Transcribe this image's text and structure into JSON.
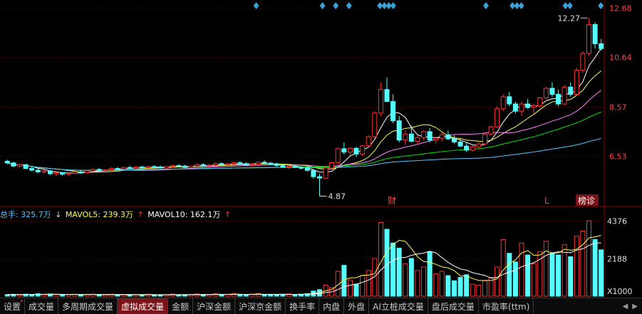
{
  "price_axis": {
    "ticks": [
      "12.68",
      "10.64",
      "8.57",
      "6.53"
    ]
  },
  "volume_axis": {
    "ticks": [
      "4376",
      "2188"
    ],
    "unit": "X1000"
  },
  "annotations": {
    "max_price": "12.27",
    "min_price": "4.87",
    "marker_cai": "财",
    "marker_l": "L",
    "marker_bangzhen": "榜诊"
  },
  "volume_header": {
    "total": "总手: 325.7万",
    "mavol5": "MAVOL5: 239.3万",
    "mavol10": "MAVOL10: 162.1万"
  },
  "tabs": [
    {
      "label": "设置",
      "dot": true
    },
    {
      "label": "成交量"
    },
    {
      "label": "多周期成交量"
    },
    {
      "label": "虚拟成交量",
      "active": true
    },
    {
      "label": "金额"
    },
    {
      "label": "沪深金额"
    },
    {
      "label": "沪深京金额"
    },
    {
      "label": "换手率"
    },
    {
      "label": "内盘"
    },
    {
      "label": "外盘"
    },
    {
      "label": "AI立桩成交量"
    },
    {
      "label": "盘后成交量"
    },
    {
      "label": "市盈率(ttm)"
    }
  ],
  "colors": {
    "up": "#ff3232",
    "down": "#54ffff",
    "ma_white": "#ffffff",
    "ma_yellow": "#ffff54",
    "ma_magenta": "#ff80ff",
    "ma_green": "#00e600",
    "ma_blue": "#55c8ff",
    "diamond": "#3aa0d8"
  },
  "chart_data": {
    "type": "candlestick",
    "candles": [
      [
        6.32,
        6.38,
        6.2,
        6.25
      ],
      [
        6.25,
        6.3,
        6.08,
        6.12
      ],
      [
        6.12,
        6.22,
        6.05,
        6.18
      ],
      [
        6.18,
        6.2,
        5.98,
        6.02
      ],
      [
        6.02,
        6.1,
        5.9,
        5.95
      ],
      [
        5.95,
        6.02,
        5.82,
        5.88
      ],
      [
        5.88,
        5.98,
        5.8,
        5.92
      ],
      [
        5.92,
        5.96,
        5.75,
        5.8
      ],
      [
        5.8,
        5.9,
        5.7,
        5.85
      ],
      [
        5.85,
        5.88,
        5.72,
        5.78
      ],
      [
        5.78,
        5.86,
        5.7,
        5.82
      ],
      [
        5.82,
        5.92,
        5.78,
        5.88
      ],
      [
        5.88,
        5.95,
        5.8,
        5.84
      ],
      [
        5.84,
        5.96,
        5.8,
        5.92
      ],
      [
        5.92,
        6.02,
        5.88,
        5.98
      ],
      [
        5.98,
        6.04,
        5.9,
        5.94
      ],
      [
        5.94,
        6.0,
        5.86,
        5.96
      ],
      [
        5.96,
        6.06,
        5.92,
        6.02
      ],
      [
        6.02,
        6.08,
        5.96,
        6.0
      ],
      [
        6.0,
        6.1,
        5.96,
        6.06
      ],
      [
        6.06,
        6.14,
        6.0,
        6.04
      ],
      [
        6.04,
        6.1,
        5.98,
        6.08
      ],
      [
        6.08,
        6.14,
        6.02,
        6.06
      ],
      [
        6.06,
        6.12,
        6.0,
        6.1
      ],
      [
        6.1,
        6.16,
        6.04,
        6.08
      ],
      [
        6.08,
        6.14,
        6.02,
        6.04
      ],
      [
        6.04,
        6.12,
        6.0,
        6.1
      ],
      [
        6.1,
        6.18,
        6.06,
        6.14
      ],
      [
        6.14,
        6.2,
        6.08,
        6.12
      ],
      [
        6.12,
        6.18,
        6.04,
        6.06
      ],
      [
        6.06,
        6.14,
        6.02,
        6.12
      ],
      [
        6.12,
        6.22,
        6.08,
        6.18
      ],
      [
        6.18,
        6.24,
        6.1,
        6.14
      ],
      [
        6.14,
        6.2,
        6.08,
        6.16
      ],
      [
        6.16,
        6.26,
        6.12,
        6.22
      ],
      [
        6.22,
        6.28,
        6.14,
        6.18
      ],
      [
        6.18,
        6.24,
        6.1,
        6.2
      ],
      [
        6.2,
        6.3,
        6.16,
        6.26
      ],
      [
        6.26,
        6.32,
        6.18,
        6.22
      ],
      [
        6.22,
        6.28,
        6.14,
        6.16
      ],
      [
        6.16,
        6.24,
        6.1,
        6.2
      ],
      [
        6.2,
        6.3,
        6.16,
        6.28
      ],
      [
        6.28,
        6.36,
        6.22,
        6.24
      ],
      [
        6.24,
        6.3,
        6.16,
        6.2
      ],
      [
        6.2,
        6.26,
        6.1,
        6.14
      ],
      [
        6.14,
        6.2,
        6.04,
        6.08
      ],
      [
        6.08,
        6.16,
        6.0,
        6.12
      ],
      [
        6.12,
        6.18,
        6.04,
        6.06
      ],
      [
        6.06,
        6.12,
        5.98,
        6.04
      ],
      [
        6.04,
        6.1,
        5.9,
        5.94
      ],
      [
        5.94,
        6.0,
        5.6,
        5.68
      ],
      [
        5.68,
        5.8,
        4.87,
        5.62
      ],
      [
        5.62,
        6.1,
        5.58,
        6.04
      ],
      [
        6.04,
        6.3,
        6.0,
        6.26
      ],
      [
        6.26,
        6.9,
        6.2,
        6.84
      ],
      [
        6.84,
        7.1,
        6.6,
        6.7
      ],
      [
        6.7,
        6.9,
        6.56,
        6.86
      ],
      [
        6.86,
        6.92,
        6.5,
        6.62
      ],
      [
        6.62,
        7.0,
        6.55,
        6.96
      ],
      [
        6.96,
        7.4,
        6.88,
        7.34
      ],
      [
        7.34,
        8.4,
        7.28,
        8.32
      ],
      [
        8.32,
        9.6,
        8.2,
        9.3
      ],
      [
        9.3,
        9.8,
        8.9,
        8.8
      ],
      [
        8.8,
        9.1,
        7.9,
        8.0
      ],
      [
        8.0,
        8.2,
        7.1,
        7.2
      ],
      [
        7.2,
        7.6,
        7.0,
        7.45
      ],
      [
        7.45,
        7.8,
        7.1,
        7.15
      ],
      [
        7.15,
        7.4,
        7.0,
        7.3
      ],
      [
        7.3,
        7.6,
        7.2,
        7.55
      ],
      [
        7.55,
        7.7,
        7.1,
        7.2
      ],
      [
        7.2,
        7.35,
        7.05,
        7.28
      ],
      [
        7.28,
        7.5,
        7.15,
        7.42
      ],
      [
        7.42,
        7.6,
        7.2,
        7.25
      ],
      [
        7.25,
        7.4,
        7.05,
        7.12
      ],
      [
        7.12,
        7.25,
        6.9,
        6.95
      ],
      [
        6.95,
        7.1,
        6.7,
        6.78
      ],
      [
        6.78,
        7.0,
        6.72,
        6.92
      ],
      [
        6.92,
        7.1,
        6.85,
        7.04
      ],
      [
        7.04,
        7.5,
        7.0,
        7.45
      ],
      [
        7.45,
        7.8,
        7.4,
        7.75
      ],
      [
        7.75,
        8.6,
        7.7,
        8.5
      ],
      [
        8.5,
        9.1,
        8.4,
        9.0
      ],
      [
        9.0,
        9.2,
        8.6,
        8.7
      ],
      [
        8.7,
        8.8,
        8.3,
        8.4
      ],
      [
        8.4,
        8.8,
        8.2,
        8.7
      ],
      [
        8.7,
        8.9,
        8.5,
        8.55
      ],
      [
        8.55,
        8.7,
        8.3,
        8.62
      ],
      [
        8.62,
        9.0,
        8.55,
        8.95
      ],
      [
        8.95,
        9.4,
        8.9,
        9.35
      ],
      [
        9.35,
        9.6,
        9.0,
        9.1
      ],
      [
        9.1,
        9.3,
        8.6,
        8.7
      ],
      [
        8.7,
        9.5,
        8.65,
        9.4
      ],
      [
        9.4,
        9.6,
        9.0,
        9.1
      ],
      [
        9.1,
        10.2,
        9.05,
        10.1
      ],
      [
        10.1,
        10.9,
        10.0,
        10.8
      ],
      [
        10.8,
        12.27,
        10.7,
        12.0
      ],
      [
        12.0,
        12.1,
        11.0,
        11.2
      ],
      [
        11.2,
        11.4,
        10.9,
        11.0
      ]
    ],
    "volumes": [
      [
        95,
        "down"
      ],
      [
        110,
        "down"
      ],
      [
        80,
        "up"
      ],
      [
        120,
        "down"
      ],
      [
        105,
        "down"
      ],
      [
        140,
        "down"
      ],
      [
        90,
        "up"
      ],
      [
        130,
        "down"
      ],
      [
        100,
        "up"
      ],
      [
        85,
        "down"
      ],
      [
        95,
        "up"
      ],
      [
        110,
        "up"
      ],
      [
        80,
        "down"
      ],
      [
        100,
        "up"
      ],
      [
        120,
        "up"
      ],
      [
        70,
        "down"
      ],
      [
        90,
        "up"
      ],
      [
        115,
        "up"
      ],
      [
        75,
        "down"
      ],
      [
        105,
        "up"
      ],
      [
        80,
        "down"
      ],
      [
        95,
        "up"
      ],
      [
        70,
        "down"
      ],
      [
        110,
        "up"
      ],
      [
        85,
        "down"
      ],
      [
        60,
        "down"
      ],
      [
        95,
        "up"
      ],
      [
        125,
        "up"
      ],
      [
        70,
        "down"
      ],
      [
        80,
        "down"
      ],
      [
        100,
        "up"
      ],
      [
        130,
        "up"
      ],
      [
        90,
        "down"
      ],
      [
        100,
        "up"
      ],
      [
        140,
        "up"
      ],
      [
        75,
        "down"
      ],
      [
        110,
        "up"
      ],
      [
        150,
        "up"
      ],
      [
        85,
        "down"
      ],
      [
        70,
        "down"
      ],
      [
        120,
        "up"
      ],
      [
        160,
        "up"
      ],
      [
        90,
        "down"
      ],
      [
        80,
        "down"
      ],
      [
        100,
        "down"
      ],
      [
        110,
        "down"
      ],
      [
        130,
        "up"
      ],
      [
        95,
        "down"
      ],
      [
        110,
        "down"
      ],
      [
        150,
        "down"
      ],
      [
        300,
        "down"
      ],
      [
        380,
        "down"
      ],
      [
        650,
        "up"
      ],
      [
        500,
        "up"
      ],
      [
        1450,
        "up"
      ],
      [
        1800,
        "down"
      ],
      [
        950,
        "up"
      ],
      [
        700,
        "down"
      ],
      [
        1200,
        "up"
      ],
      [
        1500,
        "up"
      ],
      [
        2200,
        "up"
      ],
      [
        4300,
        "up"
      ],
      [
        3900,
        "down"
      ],
      [
        3100,
        "down"
      ],
      [
        2800,
        "down"
      ],
      [
        1900,
        "up"
      ],
      [
        2200,
        "down"
      ],
      [
        1500,
        "up"
      ],
      [
        1700,
        "up"
      ],
      [
        2600,
        "down"
      ],
      [
        1300,
        "up"
      ],
      [
        1450,
        "up"
      ],
      [
        1200,
        "down"
      ],
      [
        900,
        "down"
      ],
      [
        1100,
        "down"
      ],
      [
        1250,
        "down"
      ],
      [
        700,
        "up"
      ],
      [
        650,
        "up"
      ],
      [
        900,
        "up"
      ],
      [
        1100,
        "up"
      ],
      [
        1700,
        "up"
      ],
      [
        3300,
        "up"
      ],
      [
        2500,
        "down"
      ],
      [
        2000,
        "down"
      ],
      [
        3100,
        "up"
      ],
      [
        2400,
        "down"
      ],
      [
        1900,
        "up"
      ],
      [
        2600,
        "up"
      ],
      [
        3200,
        "up"
      ],
      [
        2500,
        "down"
      ],
      [
        2400,
        "down"
      ],
      [
        3000,
        "up"
      ],
      [
        2300,
        "down"
      ],
      [
        3500,
        "up"
      ],
      [
        3800,
        "up"
      ],
      [
        4400,
        "up"
      ],
      [
        3300,
        "down"
      ],
      [
        2700,
        "down"
      ]
    ],
    "ylim_price": [
      4.5,
      12.9
    ],
    "ylim_volume": [
      0,
      4400
    ],
    "diamonds": [
      58,
      73,
      76,
      79,
      86,
      87,
      88,
      89,
      110,
      116,
      117,
      118,
      128,
      129,
      136
    ]
  }
}
